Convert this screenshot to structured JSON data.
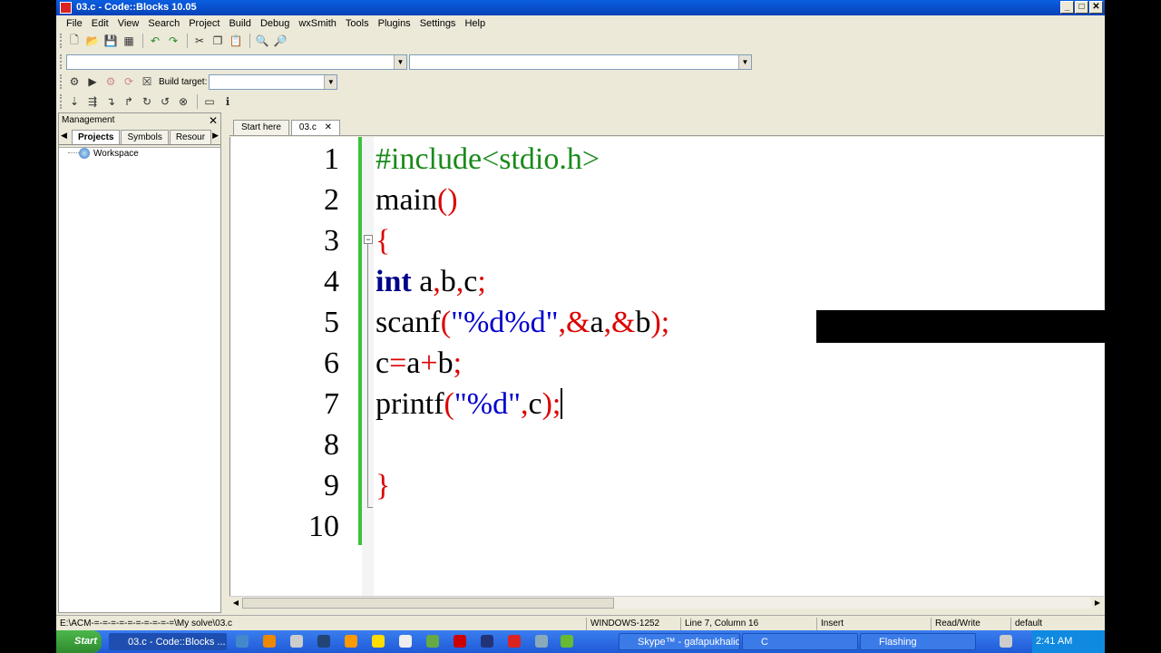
{
  "window": {
    "title": "03.c - Code::Blocks 10.05",
    "min": "_",
    "max": "□",
    "close": "✕"
  },
  "menu": [
    "File",
    "Edit",
    "View",
    "Search",
    "Project",
    "Build",
    "Debug",
    "wxSmith",
    "Tools",
    "Plugins",
    "Settings",
    "Help"
  ],
  "toolbar": {
    "build_target_label": "Build target:"
  },
  "management": {
    "title": "Management",
    "close": "✕",
    "tabs": [
      "Projects",
      "Symbols",
      "Resour"
    ],
    "left_arrow": "◀",
    "right_arrow": "▶",
    "tree": {
      "workspace": "Workspace"
    }
  },
  "editor": {
    "tabs": [
      "Start here",
      "03.c"
    ],
    "tab_close": "✕",
    "line_numbers": [
      "1",
      "2",
      "3",
      "4",
      "5",
      "6",
      "7",
      "8",
      "9",
      "10"
    ],
    "fold_marker": "−",
    "code": {
      "l1": "#include<stdio.h>",
      "l2_name": "main",
      "l2_paren": "()",
      "l3": "{",
      "l4_kw": "int",
      "l4_rest": " a",
      "l4_c1": ",",
      "l4_b": "b",
      "l4_c2": ",",
      "l4_c": "c",
      "l4_semi": ";",
      "l5_fn": "scanf",
      "l5_open": "(",
      "l5_str": "\"%d%d\"",
      "l5_c1": ",",
      "l5_amp1": "&",
      "l5_a": "a",
      "l5_c2": ",",
      "l5_amp2": "&",
      "l5_b": "b",
      "l5_close": ");",
      "l6_c": "c",
      "l6_eq": "=",
      "l6_a": "a",
      "l6_plus": "+",
      "l6_b": "b",
      "l6_semi": ";",
      "l7_fn": "printf",
      "l7_open": "(",
      "l7_str": "\"%d\"",
      "l7_c1": ",",
      "l7_c": "c",
      "l7_close": ");",
      "l9": "}"
    }
  },
  "status": {
    "path": "E:\\ACM-=-=-=-=-=-=-=-=-=-=\\My solve\\03.c",
    "encoding": "WINDOWS-1252",
    "position": "Line 7, Column 16",
    "mode": "Insert",
    "access": "Read/Write",
    "lexer": "default"
  },
  "taskbar": {
    "start": "Start",
    "tasks": [
      "03.c - Code::Blocks ...",
      "Skype™ - gafapukhalid",
      "C",
      "Flashing"
    ],
    "clock": "2:41 AM"
  }
}
